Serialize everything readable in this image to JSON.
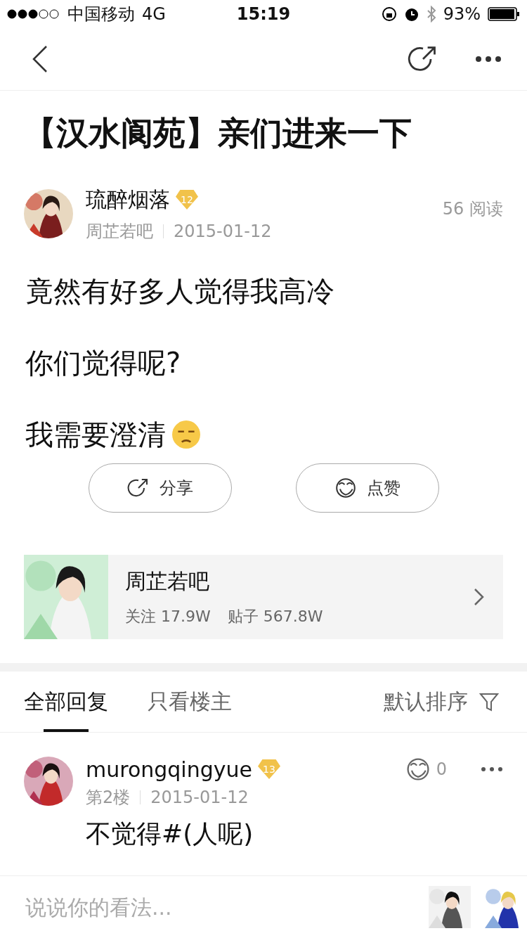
{
  "status_bar": {
    "carrier": "中国移动",
    "network": "4G",
    "time": "15:19",
    "battery": "93%"
  },
  "post": {
    "title": "【汉水阆苑】亲们进来一下",
    "author": {
      "name": "琉醉烟落",
      "level": "12",
      "forum": "周芷若吧",
      "date": "2015-01-12"
    },
    "reads": "56 阅读",
    "paragraphs": [
      {
        "text": "竟然有好多人觉得我高冷",
        "emoji": false
      },
      {
        "text": "你们觉得呢?",
        "emoji": false
      },
      {
        "text": "我需要澄清",
        "emoji": true
      }
    ]
  },
  "actions": [
    {
      "label": "分享",
      "kind": "share"
    },
    {
      "label": "点赞",
      "kind": "like"
    }
  ],
  "forum_card": {
    "name": "周芷若吧",
    "follows": "关注 17.9W",
    "posts": "贴子 567.8W"
  },
  "reply_tabs": [
    {
      "label": "全部回复",
      "selected": true
    },
    {
      "label": "只看楼主",
      "selected": false
    }
  ],
  "sort": "默认排序",
  "replies": [
    {
      "name": "murongqingyue",
      "level": "13",
      "floor": "第2楼",
      "date": "2015-01-12",
      "likes": "0",
      "text": "不觉得#(人呢)"
    }
  ],
  "comment_box": {
    "placeholder": "说说你的看法..."
  }
}
